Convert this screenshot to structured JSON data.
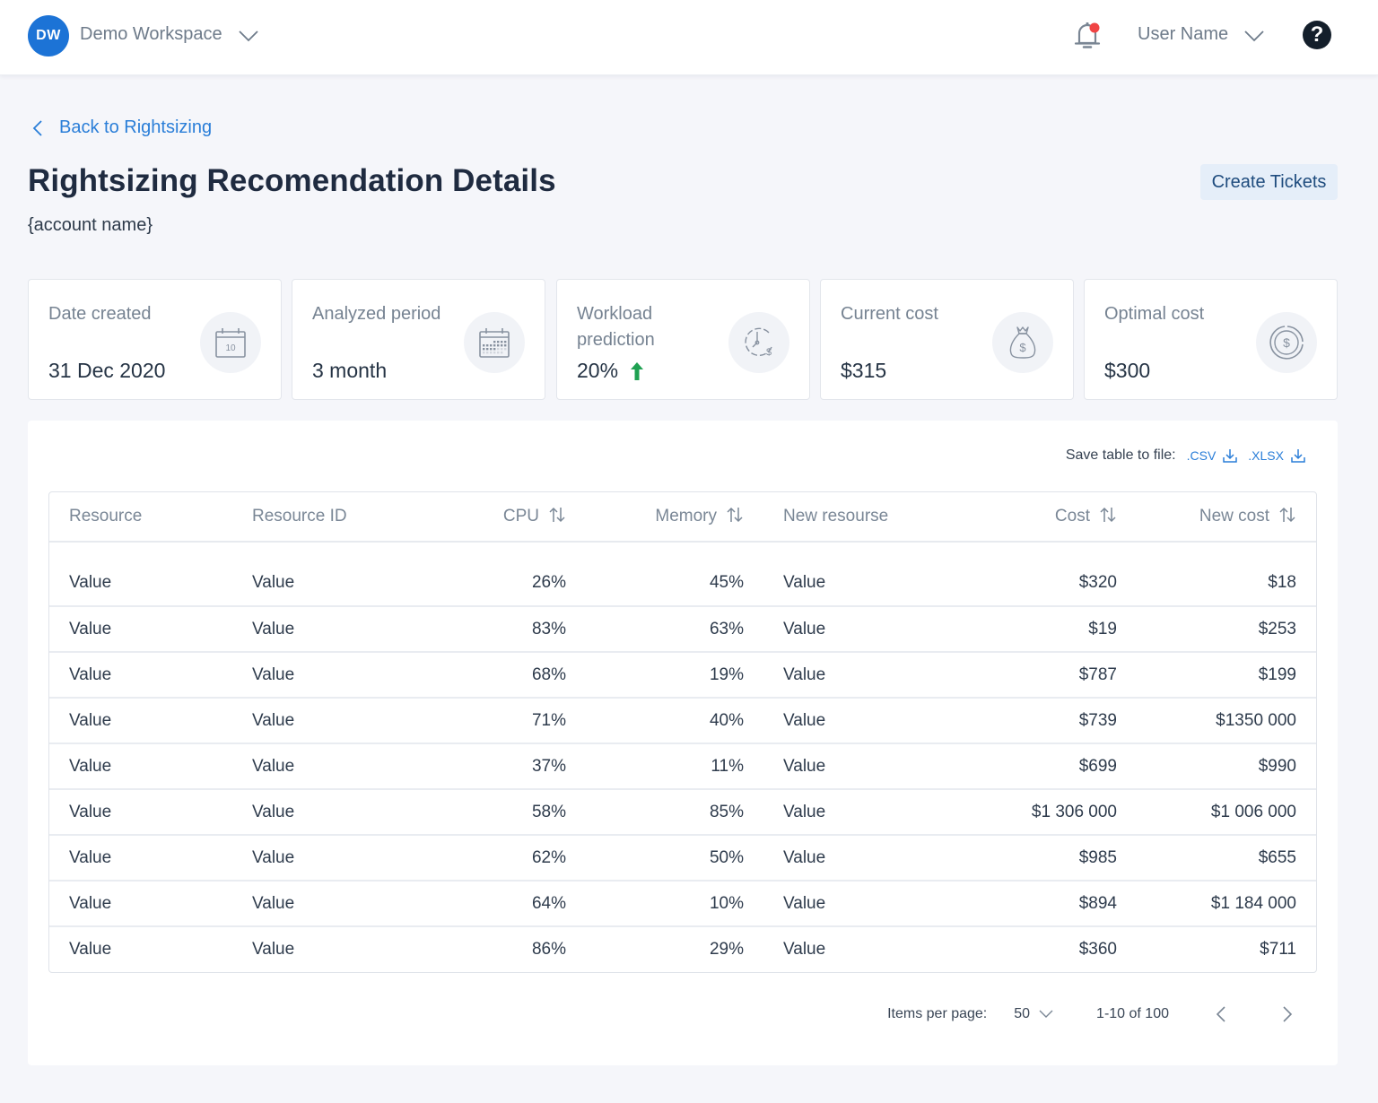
{
  "topbar": {
    "workspace_initials": "DW",
    "workspace_name": "Demo Workspace",
    "user_name": "User Name",
    "help_label": "?",
    "notification_dot_color": "#f04444"
  },
  "header": {
    "back_label": "Back to Rightsizing",
    "title": "Rightsizing Recomendation Details",
    "account_name": "{account name}",
    "create_tickets_label": "Create Tickets"
  },
  "cards": [
    {
      "label": "Date created",
      "value": "31 Dec 2020",
      "icon": "calendar-day-icon",
      "calendar_day": "10"
    },
    {
      "label": "Analyzed period",
      "value": "3 month",
      "icon": "calendar-month-icon"
    },
    {
      "label": "Workload prediction",
      "value": "20%",
      "trend": "up",
      "icon": "clock-dollar-icon"
    },
    {
      "label": "Current cost",
      "value": "$315",
      "icon": "money-bag-icon"
    },
    {
      "label": "Optimal cost",
      "value": "$300",
      "icon": "coin-dollar-icon"
    }
  ],
  "export": {
    "label": "Save table to file:",
    "csv_label": ".CSV",
    "xlsx_label": ".XLSX"
  },
  "table": {
    "columns": [
      {
        "label": "Resource",
        "sortable": false
      },
      {
        "label": "Resource ID",
        "sortable": false
      },
      {
        "label": "CPU",
        "sortable": true
      },
      {
        "label": "Memory",
        "sortable": true
      },
      {
        "label": "New resourse",
        "sortable": false
      },
      {
        "label": "Cost",
        "sortable": true
      },
      {
        "label": "New cost",
        "sortable": true
      }
    ],
    "rows": [
      [
        "Value",
        "Value",
        "26%",
        "45%",
        "Value",
        "$320",
        "$18"
      ],
      [
        "Value",
        "Value",
        "83%",
        "63%",
        "Value",
        "$19",
        "$253"
      ],
      [
        "Value",
        "Value",
        "68%",
        "19%",
        "Value",
        "$787",
        "$199"
      ],
      [
        "Value",
        "Value",
        "71%",
        "40%",
        "Value",
        "$739",
        "$1350 000"
      ],
      [
        "Value",
        "Value",
        "37%",
        "11%",
        "Value",
        "$699",
        "$990"
      ],
      [
        "Value",
        "Value",
        "58%",
        "85%",
        "Value",
        "$1 306 000",
        "$1 006 000"
      ],
      [
        "Value",
        "Value",
        "62%",
        "50%",
        "Value",
        "$985",
        "$655"
      ],
      [
        "Value",
        "Value",
        "64%",
        "10%",
        "Value",
        "$894",
        "$1 184 000"
      ],
      [
        "Value",
        "Value",
        "86%",
        "29%",
        "Value",
        "$360",
        "$711"
      ]
    ]
  },
  "pagination": {
    "items_per_page_label": "Items per page:",
    "items_per_page_value": "50",
    "range": "1-10 of 100"
  },
  "colors": {
    "accent": "#2a7ed8",
    "avatar": "#1c73d6",
    "trend_up": "#1fa152",
    "title": "#1f2b40"
  }
}
